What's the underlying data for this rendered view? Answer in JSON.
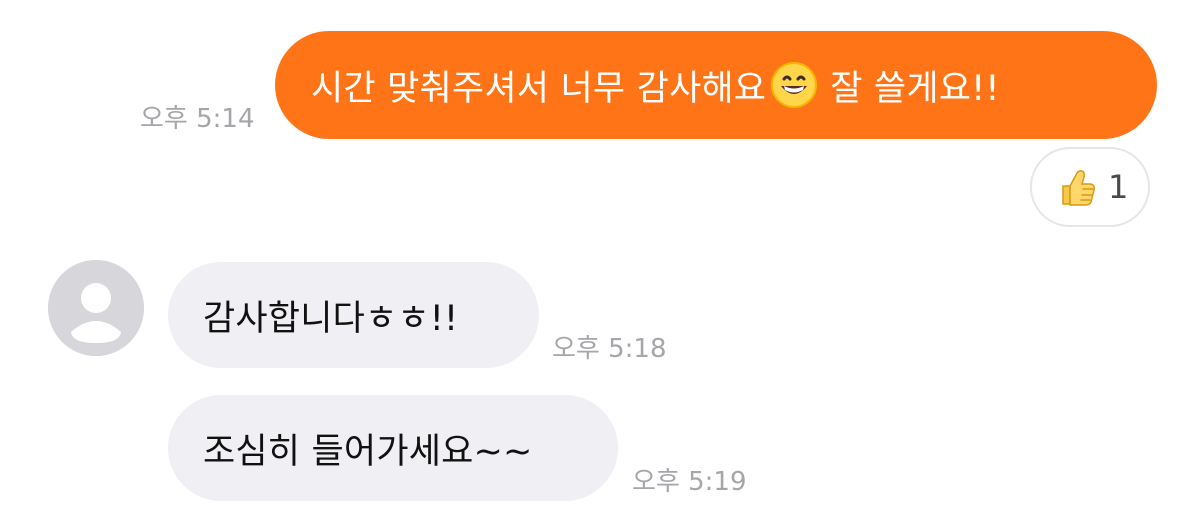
{
  "conversation": {
    "messages": [
      {
        "direction": "outgoing",
        "text_before_emoji": "시간 맞춰주셔서 너무 감사해요",
        "emoji_icon": "grinning-face-emoji",
        "text_after_emoji": "잘 쓸게요!!",
        "time": "오후 5:14",
        "reaction": {
          "icon": "thumbs-up-emoji",
          "count": "1"
        }
      },
      {
        "direction": "incoming",
        "text": "감사합니다ㅎㅎ!!",
        "time": "오후 5:18"
      },
      {
        "direction": "incoming",
        "text": "조심히 들어가세요~~",
        "time": "오후 5:19"
      }
    ]
  },
  "colors": {
    "outgoing_bubble": "#ff7416",
    "incoming_bubble": "#f0f0f4",
    "timestamp": "#a6a6aa",
    "avatar_background": "#d7d7db"
  }
}
